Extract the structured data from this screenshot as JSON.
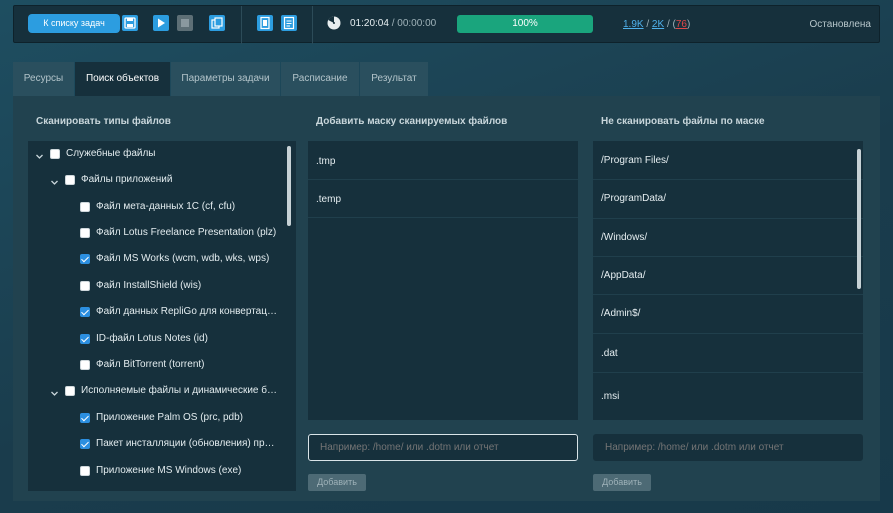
{
  "toolbar": {
    "back_label": "К списку задач",
    "icons": [
      "save-icon",
      "play-icon",
      "stop-icon",
      "copy-icon",
      "clone-icon",
      "report-icon"
    ],
    "elapsed": "01:20:04",
    "separator": "/",
    "total": "00:00:00",
    "progress_percent": 100,
    "progress_label": "100%",
    "count_a": "1.9K",
    "count_b": "2K",
    "count_c": "76",
    "count_sep": "/",
    "status": "Остановлена",
    "colors": {
      "accent": "#2c9de0",
      "progress": "#1aa57d",
      "error": "#e04848"
    }
  },
  "tabs": [
    {
      "label": "Ресурсы"
    },
    {
      "label": "Поиск объектов",
      "active": true
    },
    {
      "label": "Параметры задачи"
    },
    {
      "label": "Расписание"
    },
    {
      "label": "Результат"
    }
  ],
  "columns": {
    "types_title": "Сканировать типы файлов",
    "include_title": "Добавить маску сканируемых файлов",
    "exclude_title": "Не сканировать файлы по маске"
  },
  "tree": [
    {
      "label": "Служебные файлы",
      "level": 0,
      "expanded": true,
      "checked": false
    },
    {
      "label": "Файлы приложений",
      "level": 1,
      "expanded": true,
      "checked": false
    },
    {
      "label": "Файл мета-данных 1С (cf,  cfu)",
      "level": 2,
      "checked": false
    },
    {
      "label": "Файл Lotus Freelance Presentation (plz)",
      "level": 2,
      "checked": false
    },
    {
      "label": "Файл MS Works (wcm, wdb, wks, wps)",
      "level": 2,
      "checked": true
    },
    {
      "label": "Файл InstallShield (wis)",
      "level": 2,
      "checked": false
    },
    {
      "label": "Файл данных RepliGo для конвертаци...",
      "level": 2,
      "checked": true
    },
    {
      "label": "ID-файл Lotus Notes (id)",
      "level": 2,
      "checked": true
    },
    {
      "label": "Файл BitTorrent (torrent)",
      "level": 2,
      "checked": false
    },
    {
      "label": "Исполняемые файлы и динамические би...",
      "level": 1,
      "expanded": true,
      "checked": false
    },
    {
      "label": "Приложение Palm OS (prc, pdb)",
      "level": 2,
      "checked": true
    },
    {
      "label": "Пакет инсталляции (обновления) при...",
      "level": 2,
      "checked": true
    },
    {
      "label": "Приложение MS Windows (exe)",
      "level": 2,
      "checked": false
    },
    {
      "label": "",
      "level": 2,
      "checked": false
    }
  ],
  "include_masks": [
    ".tmp",
    ".temp"
  ],
  "exclude_masks": [
    "/Program Files/",
    "/ProgramData/",
    "/Windows/",
    "/AppData/",
    "/Admin$/",
    ".dat",
    ".msi"
  ],
  "include_input": {
    "placeholder": "Например: /home/ или .dotm или отчет"
  },
  "exclude_input": {
    "placeholder": "Например: /home/ или .dotm или отчет"
  },
  "add_button_label": "Добавить"
}
